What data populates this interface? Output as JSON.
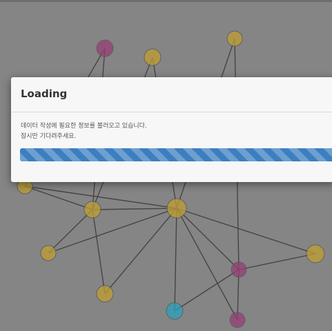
{
  "graph": {
    "nodes": [
      {
        "label": "",
        "color": "#9c3f79"
      },
      {
        "label": "",
        "color": "#c8a533"
      },
      {
        "label": "",
        "color": "#c8a533"
      },
      {
        "label": "",
        "color": "#c8a533"
      },
      {
        "label": "",
        "color": "#c8a533"
      },
      {
        "label": "",
        "color": "#c8a533"
      },
      {
        "label": "",
        "color": "#c8a533"
      },
      {
        "label": "",
        "color": "#c8a533"
      },
      {
        "label": "",
        "color": "#c8a533"
      },
      {
        "label": "",
        "color": "#9c3f79"
      },
      {
        "label": "",
        "color": "#2aa6c4"
      },
      {
        "label": "",
        "color": "#9c3f79"
      }
    ]
  },
  "modal": {
    "title": "Loading",
    "message_line1": "데이터 작성에 필요한 정보를 불러오고 있습니다.",
    "message_line2": "잠시만 기다려주세요.",
    "progress_percent": 100,
    "progress_color": "#3c7fc0"
  }
}
